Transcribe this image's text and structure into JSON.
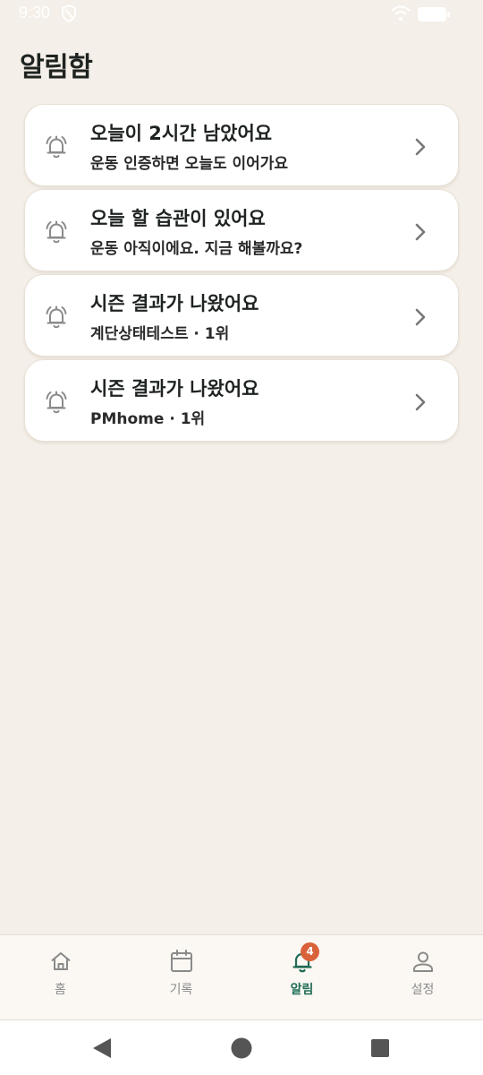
{
  "status_bar": {
    "time": "9:30"
  },
  "page": {
    "title": "알림함"
  },
  "notifications": [
    {
      "title": "오늘이 2시간 남았어요",
      "subtitle": "운동 인증하면 오늘도 이어가요"
    },
    {
      "title": "오늘 할 습관이 있어요",
      "subtitle": "운동 아직이에요. 지금 해볼까요?"
    },
    {
      "title": "시즌 결과가 나왔어요",
      "subtitle": "계단상태테스트 · 1위"
    },
    {
      "title": "시즌 결과가 나왔어요",
      "subtitle": "PMhome · 1위"
    }
  ],
  "bottom_nav": {
    "items": [
      {
        "label": "홈",
        "icon": "home-icon",
        "active": false
      },
      {
        "label": "기록",
        "icon": "calendar-icon",
        "active": false
      },
      {
        "label": "알림",
        "icon": "bell-icon",
        "active": true
      },
      {
        "label": "설정",
        "icon": "person-icon",
        "active": false
      }
    ],
    "badge_count": "4"
  },
  "colors": {
    "background": "#f4efe8",
    "card": "#ffffff",
    "accent": "#1f6b55",
    "badge": "#d9623a",
    "inactive": "#8a8a8a"
  }
}
